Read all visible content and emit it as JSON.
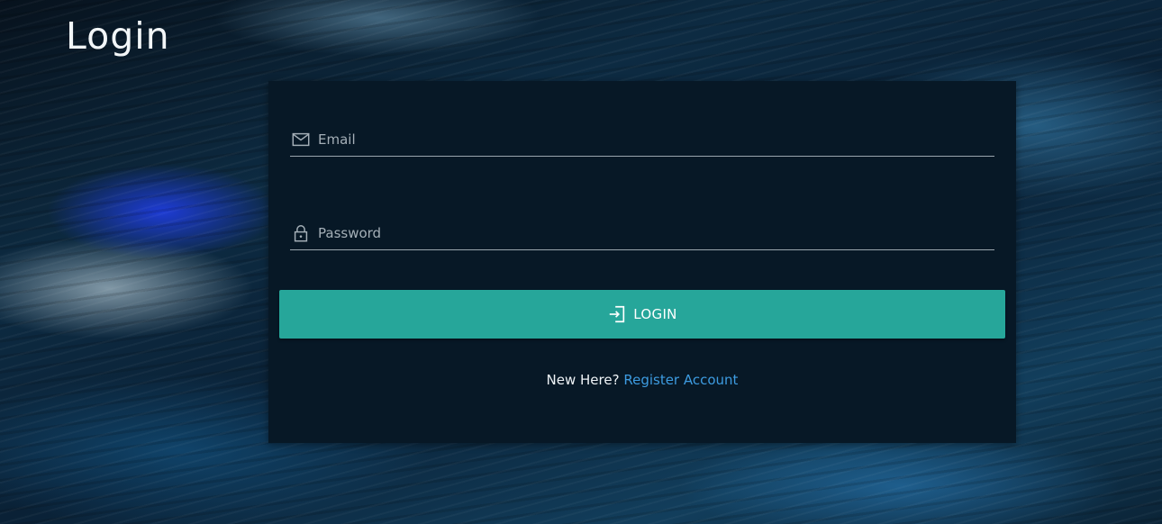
{
  "page": {
    "title": "Login"
  },
  "form": {
    "email": {
      "placeholder": "Email",
      "value": "",
      "icon": "envelope-icon"
    },
    "password": {
      "placeholder": "Password",
      "value": "",
      "icon": "lock-icon"
    },
    "login_button": {
      "label": "LOGIN",
      "icon": "login-icon",
      "color": "#26a69a"
    },
    "register": {
      "prompt": "New Here?",
      "link_label": "Register Account",
      "link_color": "#3d9be0"
    }
  },
  "colors": {
    "card_background": "#071826",
    "accent": "#26a69a"
  }
}
